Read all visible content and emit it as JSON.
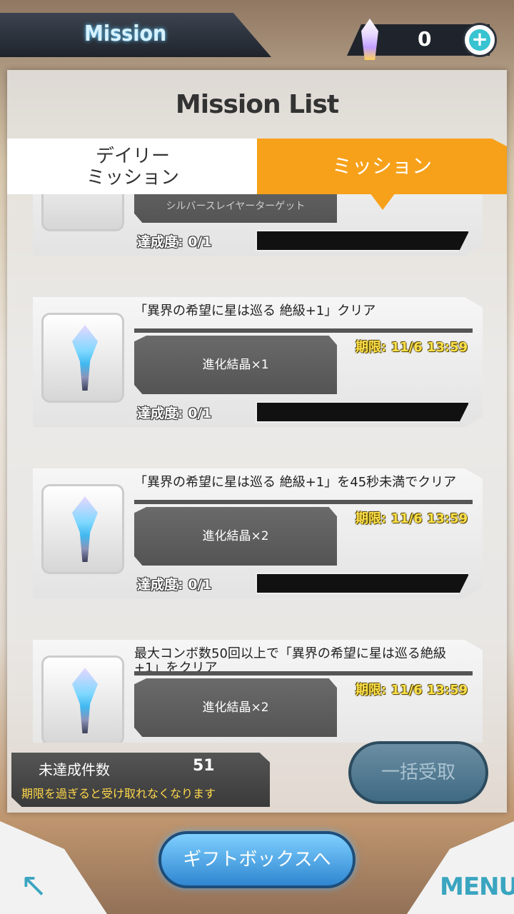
{
  "header": {
    "title": "Mission",
    "currency_value": "0",
    "add_label": "+"
  },
  "panel": {
    "title": "Mission List",
    "tabs": [
      {
        "label": "デイリー\nミッション",
        "active": false
      },
      {
        "label": "ミッション",
        "active": true
      }
    ]
  },
  "missions": [
    {
      "title": "シルバースレイヤーターゲット",
      "reward": "",
      "deadline": "",
      "progress": "達成度: 0/1",
      "partial": true
    },
    {
      "title": "「異界の希望に星は巡る 絶級+1」クリア",
      "reward": "進化結晶×1",
      "deadline": "期限: 11/6 13:59",
      "progress": "達成度: 0/1"
    },
    {
      "title": "「異界の希望に星は巡る 絶級+1」を45秒未満でクリア",
      "reward": "進化結晶×2",
      "deadline": "期限: 11/6 13:59",
      "progress": "達成度: 0/1"
    },
    {
      "title": "最大コンボ数50回以上で「異界の希望に星は巡る絶級+1」をクリア",
      "reward": "進化結晶×2",
      "deadline": "期限: 11/6 13:59",
      "progress": ""
    }
  ],
  "footer": {
    "uncompleted_label": "未達成件数",
    "uncompleted_count": "51",
    "expire_note": "期限を過ぎると受け取れなくなります",
    "claim_all_label": "一括受取",
    "gift_box_label": "ギフトボックスへ",
    "menu_label": "MENU"
  },
  "colors": {
    "accent_orange": "#f7a11a",
    "deadline_yellow": "#ffe14a",
    "cyan": "#3aa5c0"
  }
}
